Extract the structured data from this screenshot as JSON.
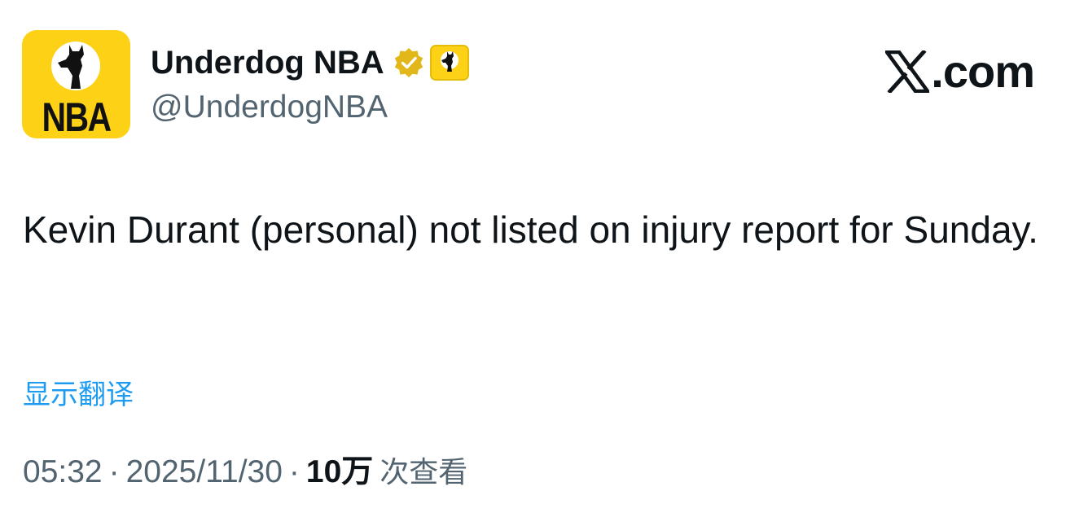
{
  "author": {
    "display_name": "Underdog NBA",
    "handle": "@UnderdogNBA",
    "avatar_text": "NBA",
    "avatar_icon": "underdog-dog-logo",
    "verified_icon": "gold-verified-badge",
    "affiliate_icon": "underdog-affiliate-badge"
  },
  "brand": {
    "text": ".com",
    "icon": "x-logo"
  },
  "tweet": {
    "text": "Kevin Durant (personal) not listed on injury report for Sunday."
  },
  "translate": {
    "label": "显示翻译"
  },
  "meta": {
    "time": "05:32",
    "separator": "·",
    "date": "2025/11/30",
    "views_count": "10万",
    "views_label": "次查看"
  },
  "colors": {
    "brand_yellow": "#fcd116",
    "gold_badge": "#e2b719",
    "link_blue": "#1d9bf0",
    "secondary_text": "#536471",
    "primary_text": "#0f1419"
  }
}
